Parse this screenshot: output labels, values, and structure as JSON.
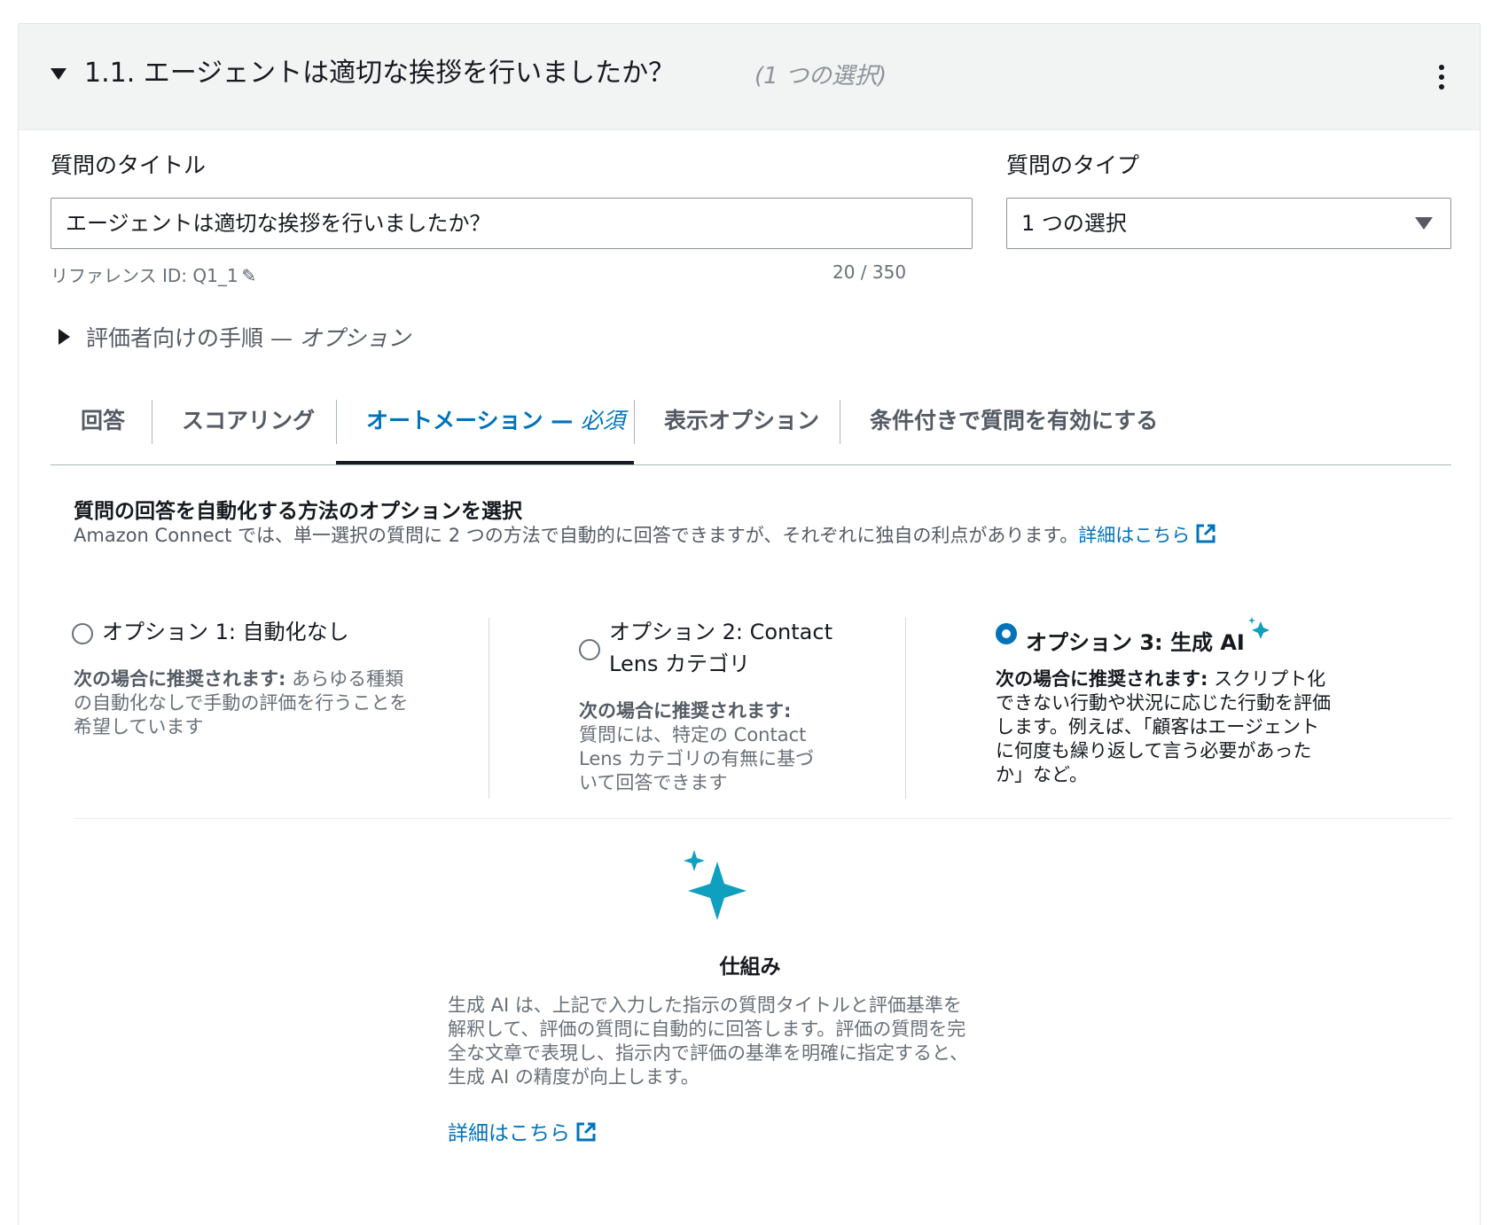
{
  "header": {
    "title": "1.1. エージェントは適切な挨拶を行いましたか？",
    "subtitle": "(1 つの選択)"
  },
  "form": {
    "title_label": "質問のタイトル",
    "title_value": "エージェントは適切な挨拶を行いましたか？",
    "reference_id": "リファレンス ID: Q1_1",
    "char_count": "20 / 350",
    "type_label": "質問のタイプ",
    "type_value": "1 つの選択"
  },
  "instructions": {
    "label": "評価者向けの手順 — ",
    "optional": "オプション"
  },
  "tabs": [
    {
      "label": "回答"
    },
    {
      "label": "スコアリング"
    },
    {
      "label": "オートメーション — ",
      "suffix": "必須",
      "active": true
    },
    {
      "label": "表示オプション"
    },
    {
      "label": "条件付きで質問を有効にする"
    }
  ],
  "automation": {
    "title": "質問の回答を自動化する方法のオプションを選択",
    "description": "Amazon Connect では、単一選択の質問に 2 つの方法で自動的に回答できますが、それぞれに独自の利点があります。",
    "learn_more": "詳細はこちら",
    "options": [
      {
        "label": "オプション 1: 自動化なし",
        "rec_label": "次の場合に推奨されます:",
        "rec_text": " あらゆる種類の自動化なしで手動の評価を行うことを希望しています",
        "selected": false
      },
      {
        "label": "オプション 2: Contact Lens カテゴリ",
        "rec_label": "次の場合に推奨されます:",
        "rec_text": "質問には、特定の Contact Lens カテゴリの有無に基づいて回答できます",
        "selected": false
      },
      {
        "label": "オプション 3: 生成 AI",
        "rec_label": "次の場合に推奨されます:",
        "rec_text": " スクリプト化できない行動や状況に応じた行動を評価します。例えば、「顧客はエージェントに何度も繰り返して言う必要があったか」など。",
        "selected": true
      }
    ]
  },
  "how_it_works": {
    "title": "仕組み",
    "description": "生成 AI は、上記で入力した指示の質問タイトルと評価基準を解釈して、評価の質問に自動的に回答します。評価の質問を完全な文章で表現し、指示内で評価の基準を明確に指定すると、生成 AI の精度が向上します。",
    "learn_more": "詳細はこちら"
  },
  "icons": {
    "collapse": "caret-down-icon",
    "menu": "kebab-menu-icon",
    "edit": "pencil-icon",
    "expand": "caret-right-icon",
    "external": "external-link-icon",
    "sparkle": "sparkle-icon"
  },
  "colors": {
    "accent": "#0073bb",
    "sparkle": "#0f9fbf",
    "header_bg": "#f2f3f3"
  }
}
